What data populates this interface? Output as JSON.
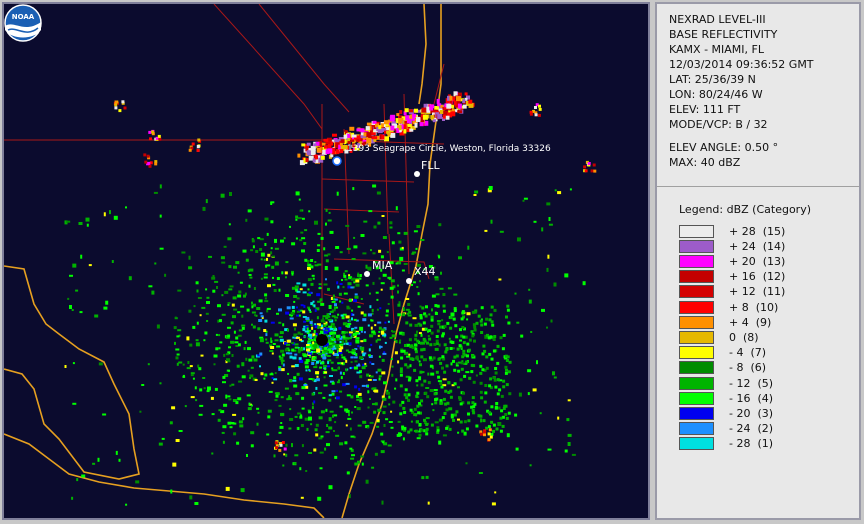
{
  "info": {
    "product": "NEXRAD LEVEL-III",
    "type": "BASE REFLECTIVITY",
    "station": "KAMX - MIAMI, FL",
    "datetime": "12/03/2014 09:36:52 GMT",
    "lat": "LAT: 25/36/39 N",
    "lon": "LON: 80/24/46 W",
    "elev": "ELEV: 111 FT",
    "mode": "MODE/VCP: B / 32",
    "elev_angle": "ELEV ANGLE: 0.50 °",
    "max": "MAX: 40 dBZ"
  },
  "legend": {
    "title": "Legend: dBZ (Category)",
    "items": [
      {
        "label": "+ 28  (15)",
        "color": "#ececec"
      },
      {
        "label": "+ 24  (14)",
        "color": "#9d5cc9"
      },
      {
        "label": "+ 20  (13)",
        "color": "#ff00ff"
      },
      {
        "label": "+ 16  (12)",
        "color": "#c40000"
      },
      {
        "label": "+ 12  (11)",
        "color": "#d40000"
      },
      {
        "label": "+ 8  (10)",
        "color": "#ff0000"
      },
      {
        "label": "+ 4  (9)",
        "color": "#ff9000"
      },
      {
        "label": "0  (8)",
        "color": "#e6b800"
      },
      {
        "label": "- 4  (7)",
        "color": "#ffff00"
      },
      {
        "label": "- 8  (6)",
        "color": "#008c00"
      },
      {
        "label": "- 12  (5)",
        "color": "#00b400"
      },
      {
        "label": "- 16  (4)",
        "color": "#00ff00"
      },
      {
        "label": "- 20  (3)",
        "color": "#0000f0"
      },
      {
        "label": "- 24  (2)",
        "color": "#1e90ff"
      },
      {
        "label": "- 28  (1)",
        "color": "#00e0e0"
      }
    ]
  },
  "map": {
    "address_label": "1393 Seagrape Circle, Weston, Florida 33326",
    "fll_label": "FLL",
    "mia_label": "MIA",
    "x44_label": "X44",
    "logo_text": "NOAA",
    "colors": {
      "background": "#0b0b2e",
      "coastline": "#e6a020",
      "roads": "#b01818"
    }
  }
}
